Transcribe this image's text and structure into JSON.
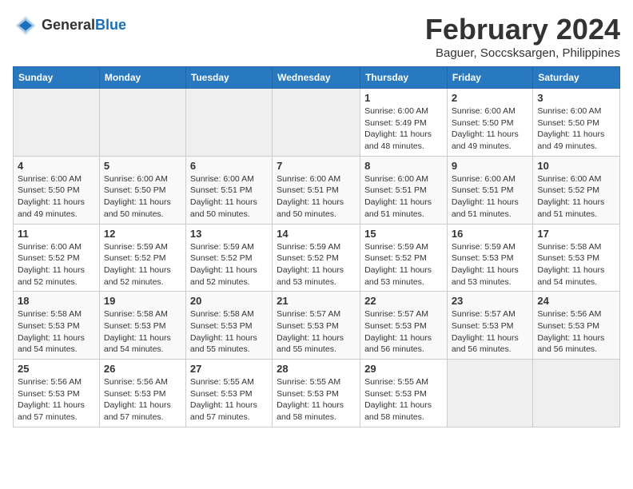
{
  "header": {
    "logo_general": "General",
    "logo_blue": "Blue",
    "month": "February 2024",
    "location": "Baguer, Soccsksargen, Philippines"
  },
  "weekdays": [
    "Sunday",
    "Monday",
    "Tuesday",
    "Wednesday",
    "Thursday",
    "Friday",
    "Saturday"
  ],
  "weeks": [
    [
      {
        "day": "",
        "info": "",
        "empty": true
      },
      {
        "day": "",
        "info": "",
        "empty": true
      },
      {
        "day": "",
        "info": "",
        "empty": true
      },
      {
        "day": "",
        "info": "",
        "empty": true
      },
      {
        "day": "1",
        "info": "Sunrise: 6:00 AM\nSunset: 5:49 PM\nDaylight: 11 hours\nand 48 minutes.",
        "empty": false
      },
      {
        "day": "2",
        "info": "Sunrise: 6:00 AM\nSunset: 5:50 PM\nDaylight: 11 hours\nand 49 minutes.",
        "empty": false
      },
      {
        "day": "3",
        "info": "Sunrise: 6:00 AM\nSunset: 5:50 PM\nDaylight: 11 hours\nand 49 minutes.",
        "empty": false
      }
    ],
    [
      {
        "day": "4",
        "info": "Sunrise: 6:00 AM\nSunset: 5:50 PM\nDaylight: 11 hours\nand 49 minutes.",
        "empty": false
      },
      {
        "day": "5",
        "info": "Sunrise: 6:00 AM\nSunset: 5:50 PM\nDaylight: 11 hours\nand 50 minutes.",
        "empty": false
      },
      {
        "day": "6",
        "info": "Sunrise: 6:00 AM\nSunset: 5:51 PM\nDaylight: 11 hours\nand 50 minutes.",
        "empty": false
      },
      {
        "day": "7",
        "info": "Sunrise: 6:00 AM\nSunset: 5:51 PM\nDaylight: 11 hours\nand 50 minutes.",
        "empty": false
      },
      {
        "day": "8",
        "info": "Sunrise: 6:00 AM\nSunset: 5:51 PM\nDaylight: 11 hours\nand 51 minutes.",
        "empty": false
      },
      {
        "day": "9",
        "info": "Sunrise: 6:00 AM\nSunset: 5:51 PM\nDaylight: 11 hours\nand 51 minutes.",
        "empty": false
      },
      {
        "day": "10",
        "info": "Sunrise: 6:00 AM\nSunset: 5:52 PM\nDaylight: 11 hours\nand 51 minutes.",
        "empty": false
      }
    ],
    [
      {
        "day": "11",
        "info": "Sunrise: 6:00 AM\nSunset: 5:52 PM\nDaylight: 11 hours\nand 52 minutes.",
        "empty": false
      },
      {
        "day": "12",
        "info": "Sunrise: 5:59 AM\nSunset: 5:52 PM\nDaylight: 11 hours\nand 52 minutes.",
        "empty": false
      },
      {
        "day": "13",
        "info": "Sunrise: 5:59 AM\nSunset: 5:52 PM\nDaylight: 11 hours\nand 52 minutes.",
        "empty": false
      },
      {
        "day": "14",
        "info": "Sunrise: 5:59 AM\nSunset: 5:52 PM\nDaylight: 11 hours\nand 53 minutes.",
        "empty": false
      },
      {
        "day": "15",
        "info": "Sunrise: 5:59 AM\nSunset: 5:52 PM\nDaylight: 11 hours\nand 53 minutes.",
        "empty": false
      },
      {
        "day": "16",
        "info": "Sunrise: 5:59 AM\nSunset: 5:53 PM\nDaylight: 11 hours\nand 53 minutes.",
        "empty": false
      },
      {
        "day": "17",
        "info": "Sunrise: 5:58 AM\nSunset: 5:53 PM\nDaylight: 11 hours\nand 54 minutes.",
        "empty": false
      }
    ],
    [
      {
        "day": "18",
        "info": "Sunrise: 5:58 AM\nSunset: 5:53 PM\nDaylight: 11 hours\nand 54 minutes.",
        "empty": false
      },
      {
        "day": "19",
        "info": "Sunrise: 5:58 AM\nSunset: 5:53 PM\nDaylight: 11 hours\nand 54 minutes.",
        "empty": false
      },
      {
        "day": "20",
        "info": "Sunrise: 5:58 AM\nSunset: 5:53 PM\nDaylight: 11 hours\nand 55 minutes.",
        "empty": false
      },
      {
        "day": "21",
        "info": "Sunrise: 5:57 AM\nSunset: 5:53 PM\nDaylight: 11 hours\nand 55 minutes.",
        "empty": false
      },
      {
        "day": "22",
        "info": "Sunrise: 5:57 AM\nSunset: 5:53 PM\nDaylight: 11 hours\nand 56 minutes.",
        "empty": false
      },
      {
        "day": "23",
        "info": "Sunrise: 5:57 AM\nSunset: 5:53 PM\nDaylight: 11 hours\nand 56 minutes.",
        "empty": false
      },
      {
        "day": "24",
        "info": "Sunrise: 5:56 AM\nSunset: 5:53 PM\nDaylight: 11 hours\nand 56 minutes.",
        "empty": false
      }
    ],
    [
      {
        "day": "25",
        "info": "Sunrise: 5:56 AM\nSunset: 5:53 PM\nDaylight: 11 hours\nand 57 minutes.",
        "empty": false
      },
      {
        "day": "26",
        "info": "Sunrise: 5:56 AM\nSunset: 5:53 PM\nDaylight: 11 hours\nand 57 minutes.",
        "empty": false
      },
      {
        "day": "27",
        "info": "Sunrise: 5:55 AM\nSunset: 5:53 PM\nDaylight: 11 hours\nand 57 minutes.",
        "empty": false
      },
      {
        "day": "28",
        "info": "Sunrise: 5:55 AM\nSunset: 5:53 PM\nDaylight: 11 hours\nand 58 minutes.",
        "empty": false
      },
      {
        "day": "29",
        "info": "Sunrise: 5:55 AM\nSunset: 5:53 PM\nDaylight: 11 hours\nand 58 minutes.",
        "empty": false
      },
      {
        "day": "",
        "info": "",
        "empty": true
      },
      {
        "day": "",
        "info": "",
        "empty": true
      }
    ]
  ]
}
